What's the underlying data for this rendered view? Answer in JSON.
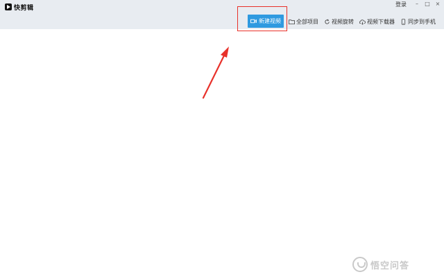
{
  "app": {
    "name": "快剪辑"
  },
  "window": {
    "login_label": "登录",
    "minimize": "–",
    "maximize": "□",
    "close": "×"
  },
  "toolbar": {
    "new_video": "新建视频",
    "all_projects": "全部项目",
    "video_rotate": "视频旋转",
    "video_downloader": "视频下载器",
    "sync_to_phone": "同步到手机"
  },
  "watermark": {
    "text": "悟空问答"
  },
  "colors": {
    "titlebar": "#e8ecf1",
    "accent": "#2f9ae0",
    "annotation": "#e8312a"
  }
}
